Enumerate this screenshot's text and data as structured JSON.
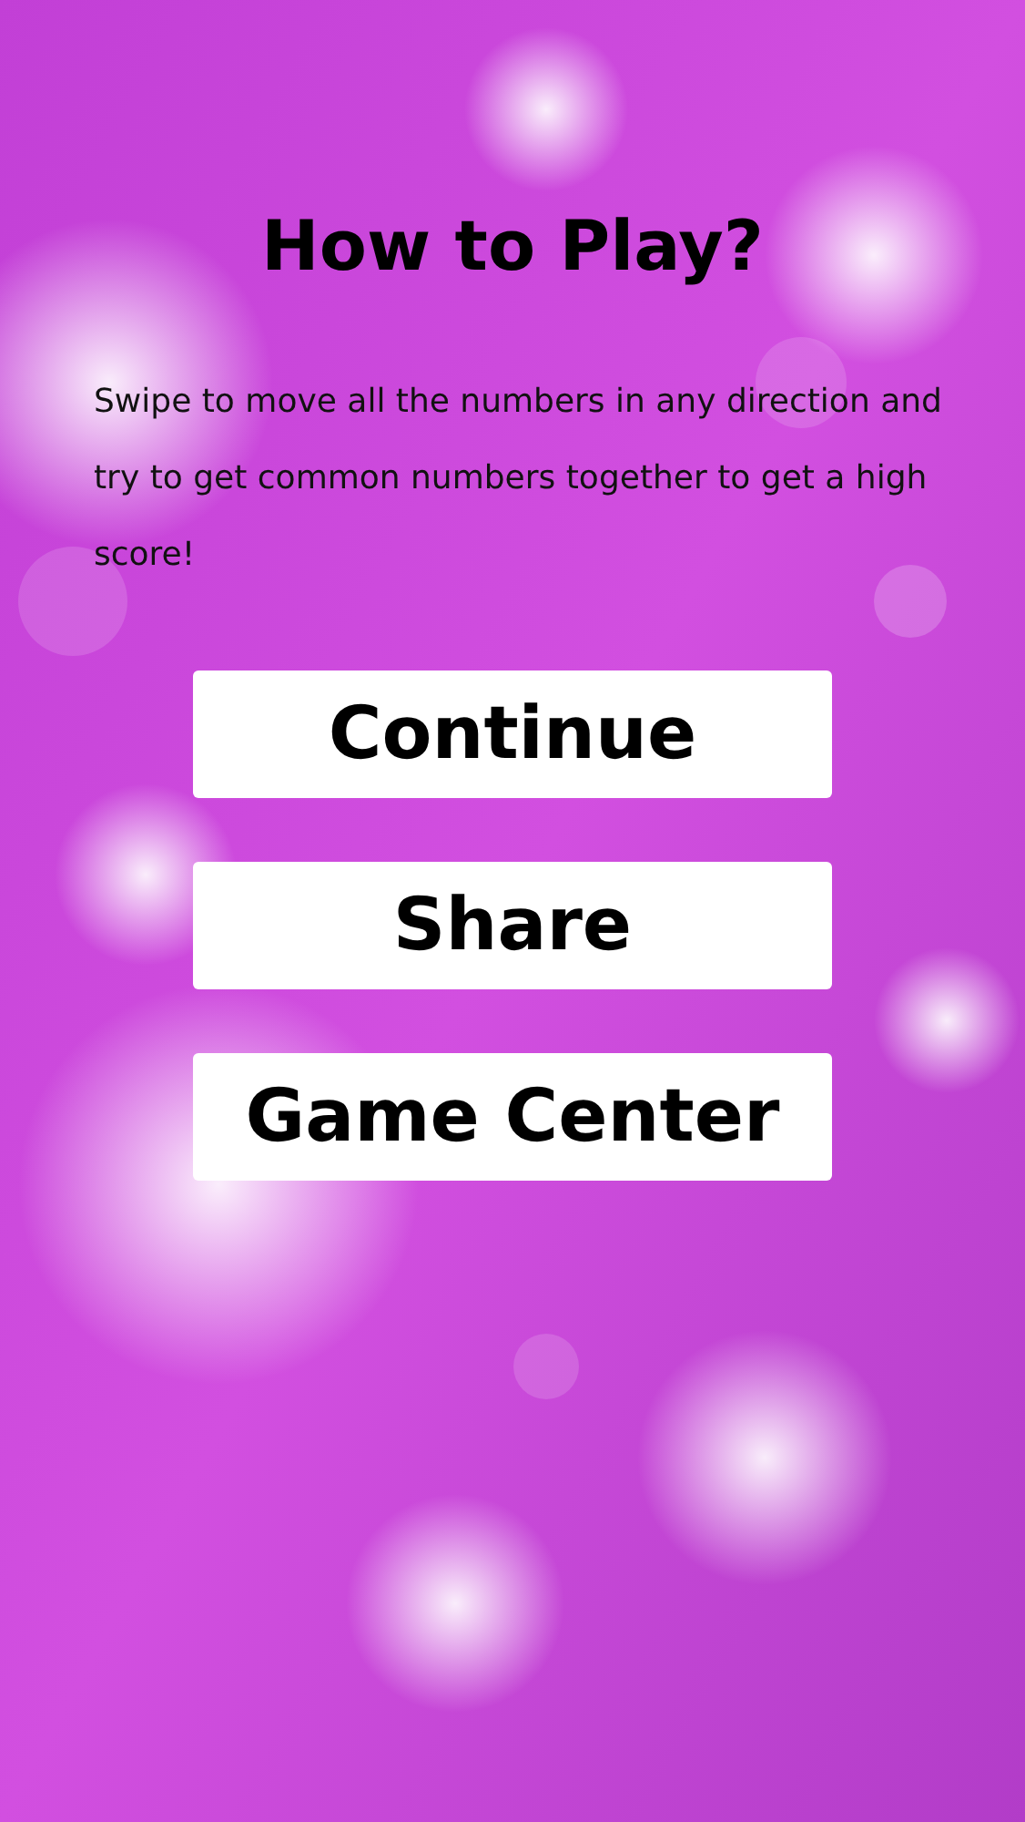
{
  "title": "How to Play?",
  "instructions": "Swipe to move all the numbers in any direction and try to get common numbers together to get a high score!",
  "buttons": [
    {
      "label": "Continue"
    },
    {
      "label": "Share"
    },
    {
      "label": "Game Center"
    }
  ]
}
